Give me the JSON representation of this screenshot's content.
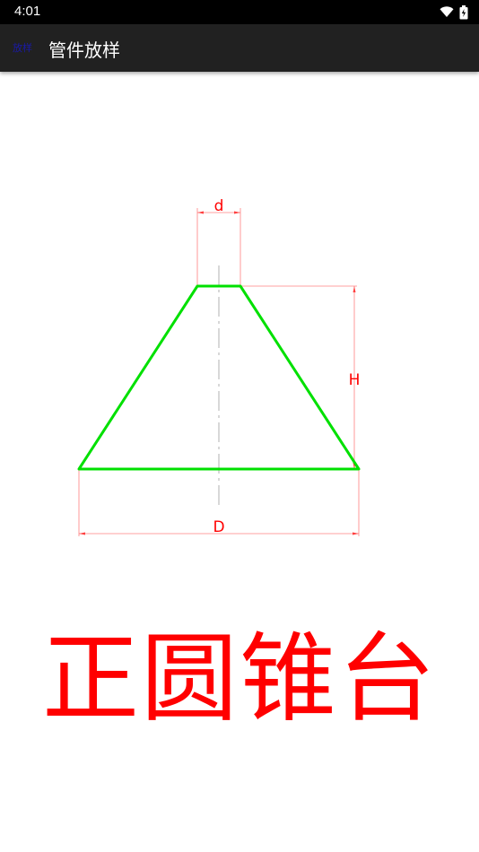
{
  "status_bar": {
    "time": "4:01",
    "icons": [
      "wifi-icon",
      "battery-icon"
    ]
  },
  "app_bar": {
    "logo_text": "放样",
    "title": "管件放样"
  },
  "diagram": {
    "labels": {
      "top_diameter": "d",
      "height": "H",
      "bottom_diameter": "D"
    },
    "colors": {
      "outline": "#00e000",
      "dimension": "#ff0000",
      "dimension_line": "#ff8080",
      "centerline": "#b0b0b0"
    }
  },
  "shape_name": "正圆锥台"
}
